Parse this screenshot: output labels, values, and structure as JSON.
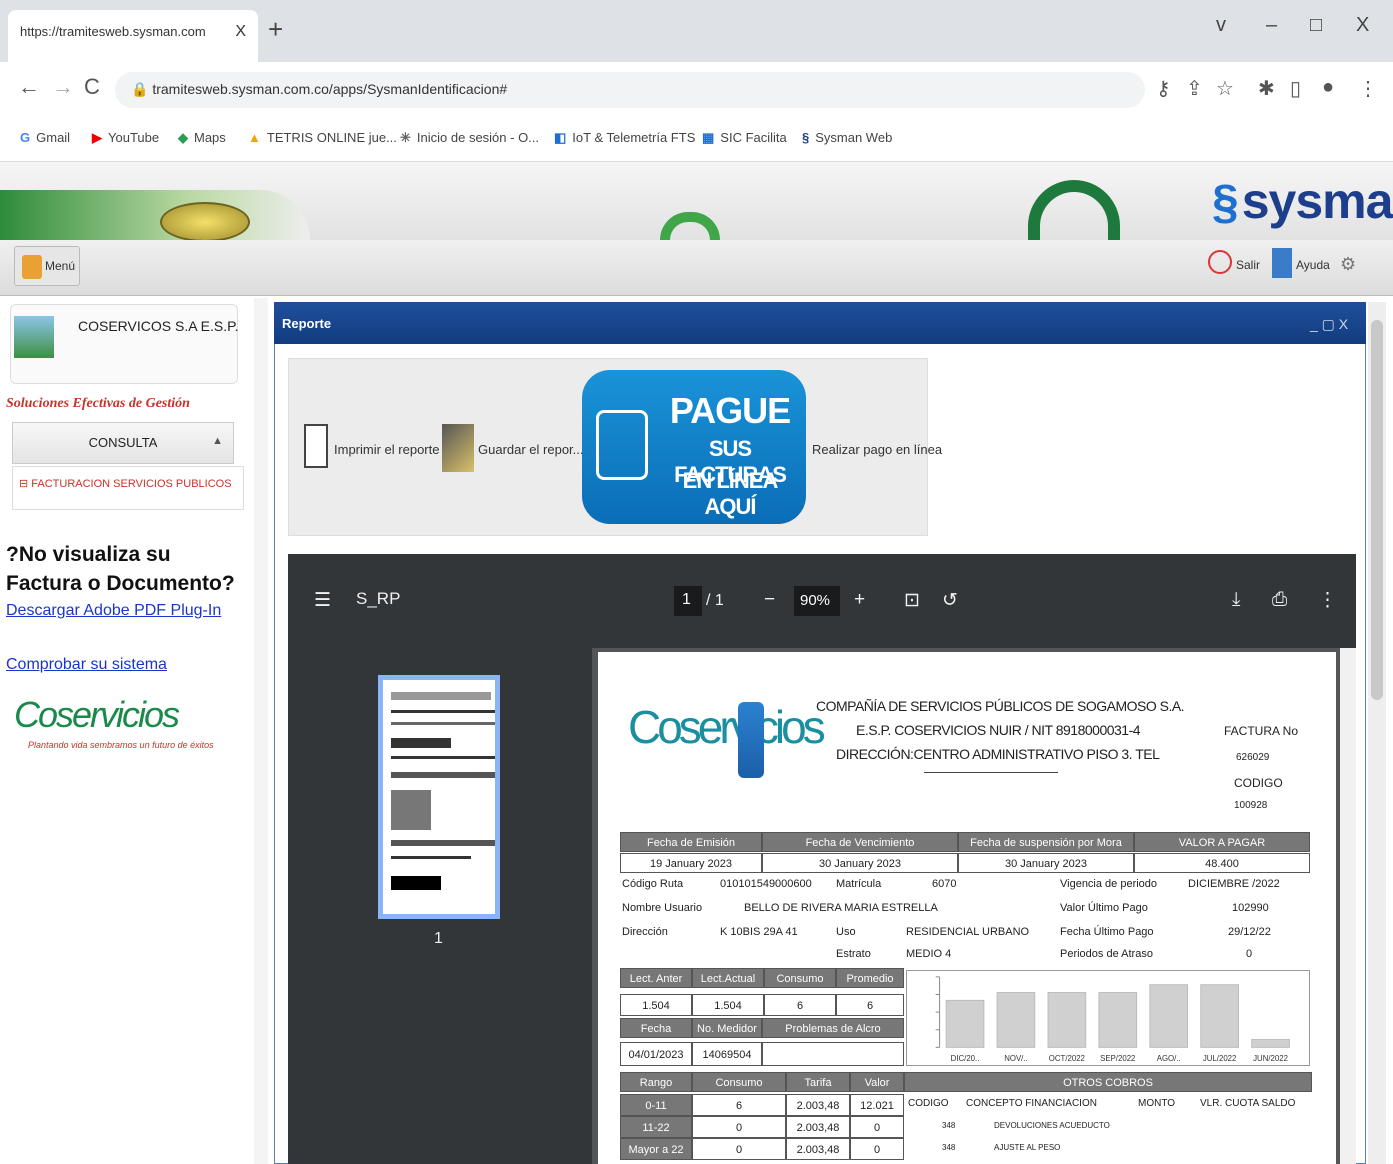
{
  "browser": {
    "tab_title": "https://tramitesweb.sysman.com",
    "tab_close": "X",
    "new_tab": "+",
    "win_controls": [
      "v",
      "–",
      "□",
      "X"
    ],
    "url": "tramitesweb.sysman.com.co/apps/SysmanIdentificacion#",
    "bookmarks": [
      "Gmail",
      "YouTube",
      "Maps",
      "TETRIS ONLINE jue...",
      "Inicio de sesión - O...",
      "IoT & Telemetría FTS",
      "SIC Facilita",
      "Sysman Web"
    ]
  },
  "app": {
    "brand": "sysman",
    "menu_label": "Menú",
    "salir_label": "Salir",
    "ayuda_label": "Ayuda"
  },
  "sidebar": {
    "company_name": "COSERVICOS S.A E.S.P.",
    "tagline": "Soluciones Efectivas de Gestión",
    "consulta_label": "CONSULTA",
    "item_label": "FACTURACION SERVICIOS PUBLICOS",
    "no_viz_text": "?No visualiza su Factura o Documento?",
    "download_link": "Descargar Adobe PDF Plug-In",
    "check_link": "Comprobar su sistema",
    "logo_text": "Coservicios",
    "logo_sub": "Plantando vida sembramos un futuro de éxitos"
  },
  "dialog": {
    "title": "Reporte",
    "controls": "_ ▢ X",
    "print_label": "Imprimir el reporte",
    "save_label": "Guardar el repor...",
    "pay_label": "Realizar pago en línea",
    "banner_l1": "PAGUE",
    "banner_l2": "SUS FACTURAS",
    "banner_l3": "EN LÍNEA AQUÍ"
  },
  "pdf": {
    "filename": "S_RP",
    "page_current": "1",
    "page_total": "/ 1",
    "zoom": "90%",
    "thumb_page": "1"
  },
  "invoice": {
    "logo": "Coservicios",
    "header_l1": "COMPAÑÍA DE SERVICIOS PÚBLICOS DE SOGAMOSO S.A.",
    "header_l2": "E.S.P. COSERVICIOS NUIR / NIT 8918000031-4",
    "header_l3": "DIRECCIÓN:CENTRO ADMINISTRATIVO PISO 3. TEL",
    "factura_label": "FACTURA No",
    "factura_no": "626029",
    "codigo_label": "CODIGO",
    "codigo": "100928",
    "dates_headers": [
      "Fecha de Emisión",
      "Fecha de Vencimiento",
      "Fecha de suspensión por Mora",
      "VALOR A PAGAR"
    ],
    "dates_values": [
      "19 January 2023",
      "30 January 2023",
      "30 January 2023",
      "48.400"
    ],
    "info": {
      "codigo_ruta_label": "Código Ruta",
      "codigo_ruta": "010101549000600",
      "matricula_label": "Matrícula",
      "matricula": "6070",
      "vigencia_label": "Vigencia de periodo",
      "vigencia": "DICIEMBRE /2022",
      "nombre_label": "Nombre Usuario",
      "nombre": "BELLO DE RIVERA MARIA ESTRELLA",
      "valor_ultimo_label": "Valor Último Pago",
      "valor_ultimo": "102990",
      "direccion_label": "Dirección",
      "direccion": "K 10BIS 29A 41",
      "uso_label": "Uso",
      "uso": "RESIDENCIAL URBANO",
      "fecha_ultimo_label": "Fecha Último Pago",
      "fecha_ultimo": "29/12/22",
      "estrato_label": "Estrato",
      "estrato": "MEDIO 4",
      "periodos_label": "Periodos de Atraso",
      "periodos": "0"
    },
    "lect_headers": [
      "Lect. Anter",
      "Lect.Actual",
      "Consumo",
      "Promedio"
    ],
    "lect_values": [
      "1.504",
      "1.504",
      "6",
      "6"
    ],
    "med_headers": [
      "Fecha",
      "No. Medidor",
      "Problemas de Alcro"
    ],
    "med_values": [
      "04/01/2023",
      "14069504",
      ""
    ],
    "rango_headers": [
      "Rango",
      "Consumo",
      "Tarifa",
      "Valor"
    ],
    "rango_rows": [
      [
        "0-11",
        "6",
        "2.003,48",
        "12.021"
      ],
      [
        "11-22",
        "0",
        "2.003,48",
        "0"
      ],
      [
        "Mayor a 22",
        "0",
        "2.003,48",
        "0"
      ]
    ],
    "otros_title": "OTROS COBROS",
    "otros_headers": [
      "CODIGO",
      "CONCEPTO FINANCIACION",
      "MONTO",
      "VLR. CUOTA SALDO"
    ],
    "otros_rows": [
      [
        "348",
        "DEVOLUCIONES ACUEDUCTO"
      ],
      [
        "348",
        "AJUSTE AL PESO"
      ]
    ]
  },
  "chart_data": {
    "type": "bar",
    "categories": [
      "DIC/20..",
      "NOV/..",
      "OCT/2022",
      "SEP/2022",
      "AGO/..",
      "JUL/2022",
      "JUN/2022"
    ],
    "values": [
      6,
      7,
      7,
      7,
      8,
      8,
      1
    ],
    "ylim": [
      0,
      9
    ],
    "grid": false,
    "bar_color": "#d0d0d0"
  }
}
